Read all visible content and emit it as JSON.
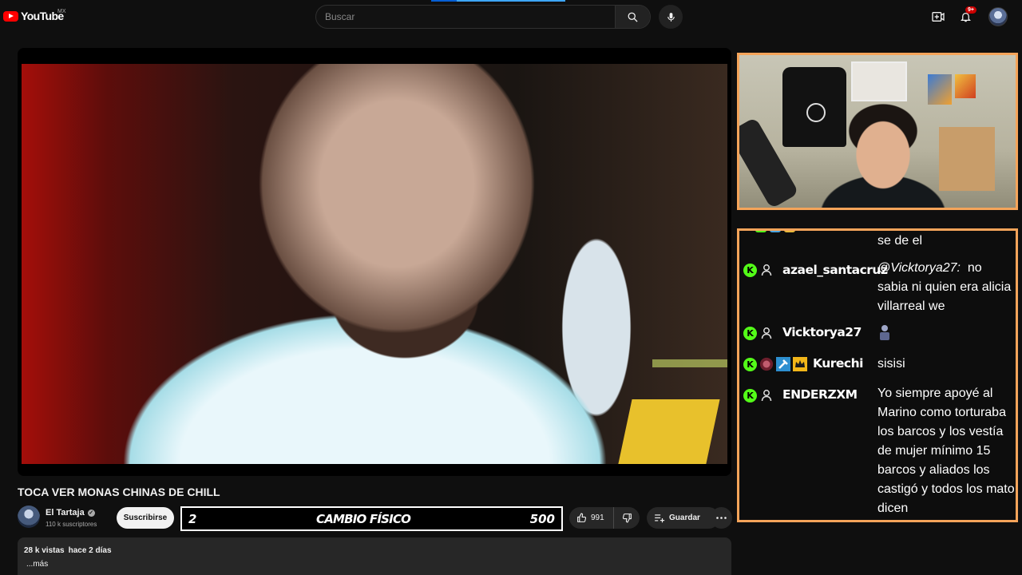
{
  "header": {
    "logo_text": "YouTube",
    "country_code": "MX",
    "search_placeholder": "Buscar",
    "notifications_badge": "9+"
  },
  "overlay": {
    "left_number": "2",
    "title": "CAMBIO FÍSICO",
    "right_number": "500"
  },
  "video": {
    "title": "TOCA VER MONAS CHINAS DE CHILL",
    "channel_name": "El Tartaja",
    "subscribers": "110 k suscriptores",
    "subscribe_label": "Suscribirse",
    "likes": "991",
    "save_label": "Guardar",
    "views": "28 k vistas",
    "age": "hace 2 días",
    "more_label": "...más"
  },
  "chat": {
    "messages": [
      {
        "user": "",
        "text": "se de el"
      },
      {
        "user": "azael_santacruz",
        "mention": "@Vicktorya27:",
        "text": "no sabia ni quien era alicia villarreal we"
      },
      {
        "user": "Vicktorya27",
        "text": ""
      },
      {
        "user": "Kurechi",
        "text": "sisisi"
      },
      {
        "user": "ENDERZXM",
        "text": "Yo siempre apoyé al Marino como torturaba los barcos y los vestía de mujer mínimo 15 barcos y aliados los castigó y todos los mato dicen"
      }
    ]
  },
  "colors": {
    "frame_accent": "#f5a45a",
    "kick_green": "#53fc18",
    "youtube_red": "#ff0000"
  }
}
